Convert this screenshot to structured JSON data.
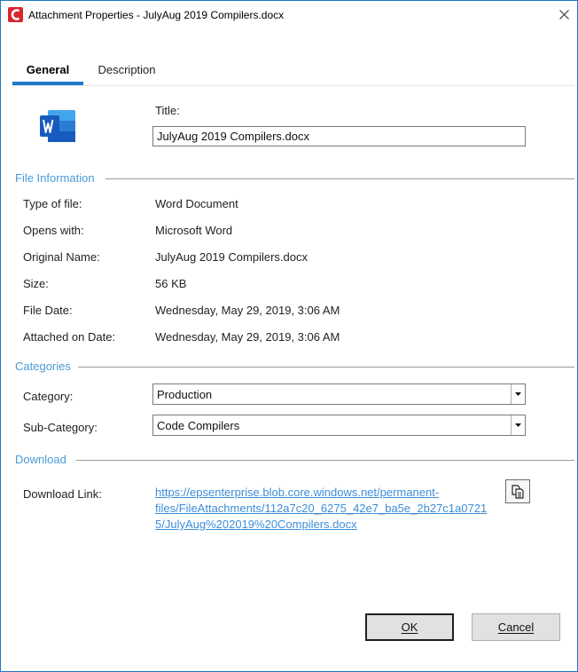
{
  "window": {
    "title": "Attachment Properties - JulyAug 2019 Compilers.docx",
    "app_icon": "app-logo-icon",
    "close_icon": "close-icon"
  },
  "tabs": [
    {
      "label": "General",
      "active": true
    },
    {
      "label": "Description",
      "active": false
    }
  ],
  "header": {
    "file_icon": "word-document-icon",
    "title_label": "Title:",
    "title_value": "JulyAug 2019 Compilers.docx"
  },
  "file_information": {
    "section_title": "File Information",
    "rows": [
      {
        "label": "Type of file:",
        "value": "Word Document"
      },
      {
        "label": "Opens with:",
        "value": "Microsoft Word"
      },
      {
        "label": "Original Name:",
        "value": "JulyAug 2019 Compilers.docx"
      },
      {
        "label": "Size:",
        "value": "56 KB"
      },
      {
        "label": "File Date:",
        "value": "Wednesday, May 29, 2019, 3:06 AM"
      },
      {
        "label": "Attached on Date:",
        "value": "Wednesday, May 29, 2019, 3:06 AM"
      }
    ]
  },
  "categories": {
    "section_title": "Categories",
    "category_label": "Category:",
    "category_value": "Production",
    "subcategory_label": "Sub-Category:",
    "subcategory_value": "Code Compilers"
  },
  "download": {
    "section_title": "Download",
    "link_label": "Download Link:",
    "link_lines": [
      "https://epsenterprise.blob.core.windows.net/permanent-",
      "files/FileAttachments/112a7c20_6275_42e7_ba5e_2b27c1a0721",
      "5/JulyAug%202019%20Compilers.docx"
    ],
    "copy_icon": "copy-icon"
  },
  "buttons": {
    "ok": "OK",
    "cancel": "Cancel"
  },
  "colors": {
    "accent": "#1f78c8",
    "section_title": "#4a9ad8",
    "link": "#3d8ed8",
    "app_icon": "#d9262c",
    "word_blue": "#185abd"
  }
}
